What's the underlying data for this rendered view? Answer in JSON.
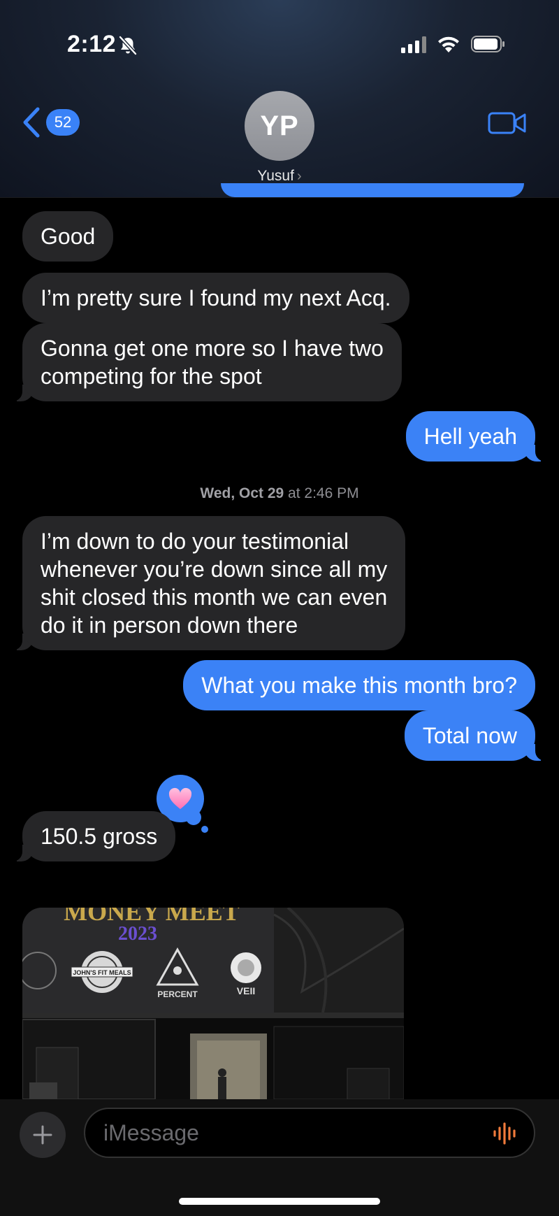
{
  "status": {
    "time": "2:12"
  },
  "header": {
    "back_count": "52",
    "avatar_initials": "YP",
    "contact_name": "Yusuf",
    "contact_chevron": "›"
  },
  "messages": [
    {
      "text": "Good",
      "direction": "incoming"
    },
    {
      "text": "I’m pretty sure I found my next Acq.",
      "direction": "incoming"
    },
    {
      "lines": [
        "Gonna get one more so I have two",
        "competing for the spot"
      ],
      "direction": "incoming"
    },
    {
      "text": "Hell yeah",
      "direction": "outgoing"
    },
    {
      "lines": [
        "I’m down to do your testimonial",
        "whenever you’re down since all my",
        "shit closed this month we can even",
        "do it in person down there"
      ],
      "direction": "incoming"
    },
    {
      "text": "What you make this month bro?",
      "direction": "outgoing"
    },
    {
      "text": "Total now",
      "direction": "outgoing"
    },
    {
      "text": "150.5 gross",
      "direction": "incoming",
      "reaction": "heart"
    }
  ],
  "timestamp": {
    "day": "Wed, Oct 29",
    "at": " at ",
    "time": "2:46 PM"
  },
  "photo": {
    "banner_title": "MONEY MEET",
    "banner_year": "2023",
    "logos": [
      "JOHN'S FIT MEALS",
      "PERCENT",
      "VEII"
    ]
  },
  "composer": {
    "placeholder": "iMessage"
  },
  "colors": {
    "outgoing": "#3b82f6",
    "incoming": "#262628",
    "accent": "#3a82f7",
    "audio": "#f07a3b"
  },
  "icons": [
    "bell-slash-icon",
    "signal-icon",
    "wifi-icon",
    "battery-icon",
    "back-chevron-icon",
    "video-camera-icon",
    "heart-icon",
    "plus-icon",
    "audio-wave-icon"
  ]
}
